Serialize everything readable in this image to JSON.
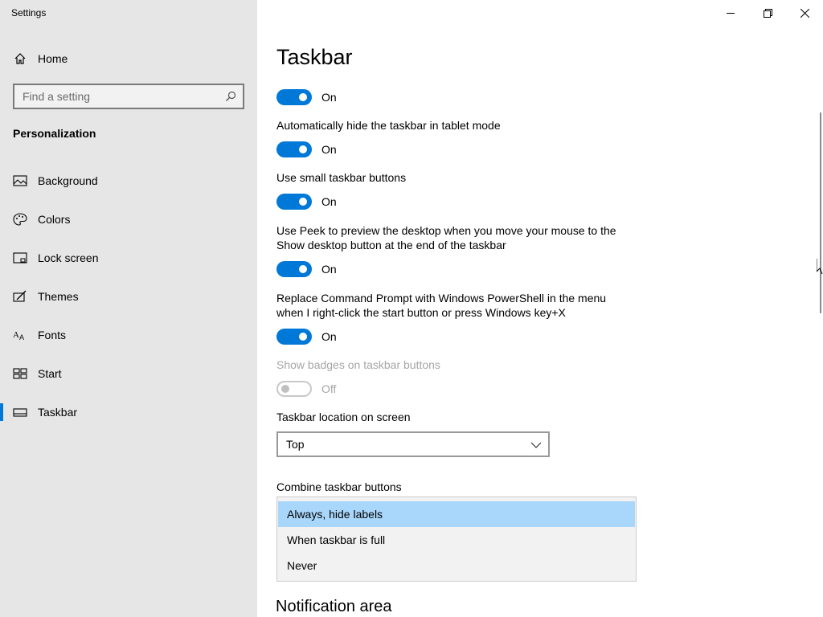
{
  "window": {
    "title": "Settings"
  },
  "sidebar": {
    "home_label": "Home",
    "search_placeholder": "Find a setting",
    "section_title": "Personalization",
    "items": [
      {
        "label": "Background",
        "icon": "image-icon"
      },
      {
        "label": "Colors",
        "icon": "palette-icon"
      },
      {
        "label": "Lock screen",
        "icon": "lock-screen-icon"
      },
      {
        "label": "Themes",
        "icon": "themes-icon"
      },
      {
        "label": "Fonts",
        "icon": "fonts-icon"
      },
      {
        "label": "Start",
        "icon": "start-icon"
      },
      {
        "label": "Taskbar",
        "icon": "taskbar-icon",
        "active": true
      }
    ]
  },
  "main": {
    "title": "Taskbar",
    "settings": [
      {
        "label": "",
        "state": "On"
      },
      {
        "label": "Automatically hide the taskbar in tablet mode",
        "state": "On"
      },
      {
        "label": "Use small taskbar buttons",
        "state": "On"
      },
      {
        "label": "Use Peek to preview the desktop when you move your mouse to the Show desktop button at the end of the taskbar",
        "state": "On"
      },
      {
        "label": "Replace Command Prompt with Windows PowerShell in the menu when I right-click the start button or press Windows key+X",
        "state": "On"
      },
      {
        "label": "Show badges on taskbar buttons",
        "state": "Off"
      }
    ],
    "location_label": "Taskbar location on screen",
    "location_value": "Top",
    "combine_label": "Combine taskbar buttons",
    "combine_options": [
      "Always, hide labels",
      "When taskbar is full",
      "Never"
    ],
    "notification_heading": "Notification area"
  },
  "colors": {
    "accent": "#0078d7",
    "sidebar_bg": "#e6e6e6",
    "selected_option": "#a9d6fb"
  }
}
